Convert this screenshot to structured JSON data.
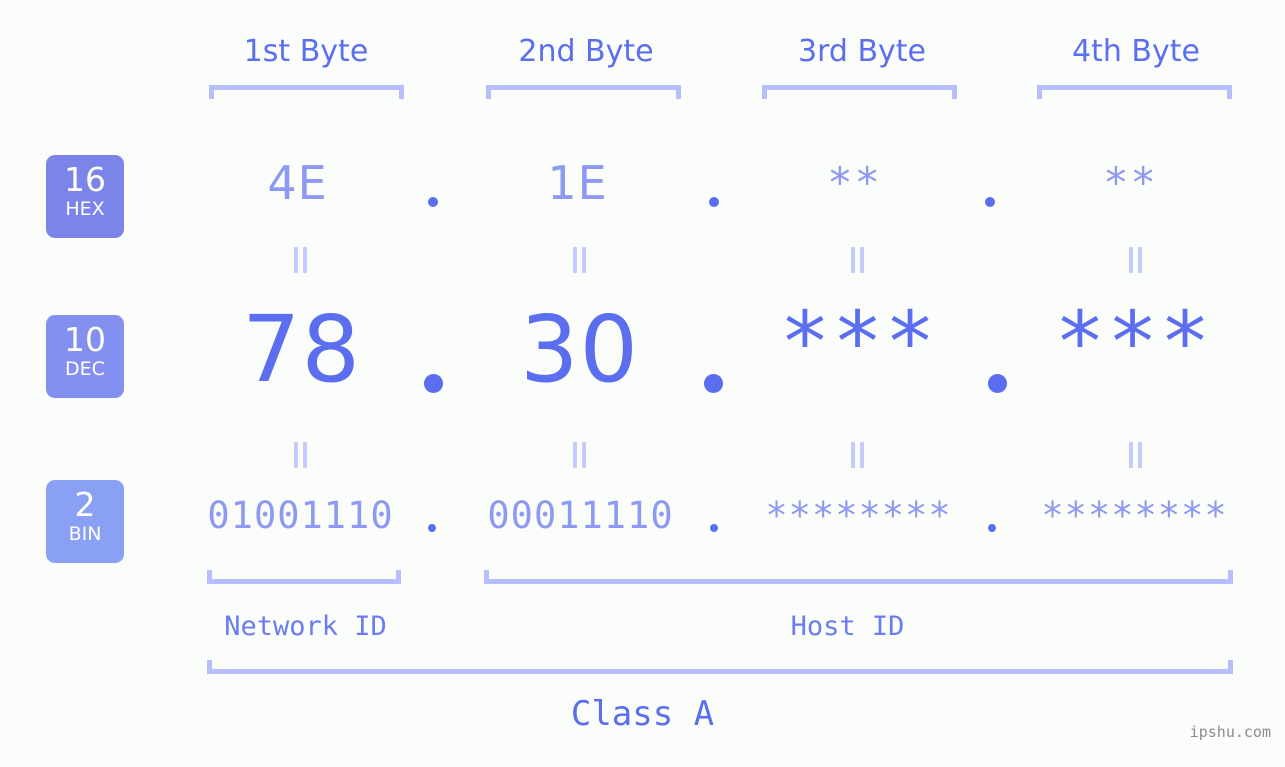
{
  "canvas": {
    "background": "#fbfdfa"
  },
  "palette": {
    "accent_strong": "#5b6ef0",
    "accent_mid": "#8d99f2",
    "accent_light": "#b6bffb",
    "bracket": "#b6bffb",
    "watermark": "#8c8c8c"
  },
  "byte_headers": [
    {
      "label": "1st Byte"
    },
    {
      "label": "2nd Byte"
    },
    {
      "label": "3rd Byte"
    },
    {
      "label": "4th Byte"
    }
  ],
  "bases": [
    {
      "number": "16",
      "name": "HEX",
      "color": "#7b84e8"
    },
    {
      "number": "10",
      "name": "DEC",
      "color": "#8490ef"
    },
    {
      "number": "2",
      "name": "BIN",
      "color": "#8aa0f5"
    }
  ],
  "rows": {
    "hex": {
      "base": "16",
      "values": [
        "4E",
        "1E",
        "**",
        "**"
      ],
      "separator": "."
    },
    "dec": {
      "base": "10",
      "values": [
        "78",
        "30",
        "***",
        "***"
      ],
      "separator": "."
    },
    "bin": {
      "base": "2",
      "values": [
        "01001110",
        "00011110",
        "********",
        "********"
      ],
      "separator": "."
    }
  },
  "equality_symbol": "=",
  "sections": [
    {
      "label": "Network ID"
    },
    {
      "label": "Host ID"
    }
  ],
  "class": {
    "label": "Class A"
  },
  "watermark": {
    "text": "ipshu.com"
  },
  "ip": {
    "dotted_decimal": "78.30.***.***",
    "hex": "4E.1E.**.**",
    "binary": "01001110.00011110.********.********",
    "class": "A",
    "network_id_bytes": 1,
    "host_id_bytes": 3
  }
}
